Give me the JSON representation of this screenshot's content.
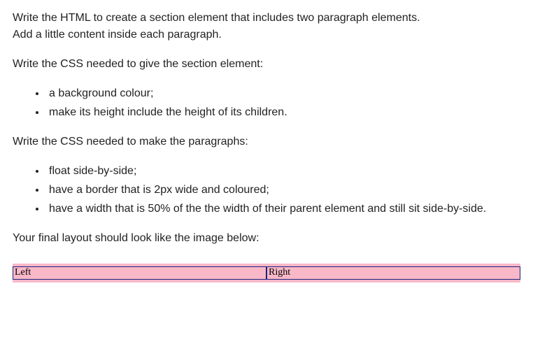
{
  "intro": {
    "line1": "Write the HTML to create a section element that includes two paragraph elements.",
    "line2": "Add a little content inside each paragraph."
  },
  "section_css_intro": "Write the CSS needed to give the section element:",
  "section_css_items": [
    "a background colour;",
    "make its height include the height of its children."
  ],
  "para_css_intro": "Write the CSS needed to make the paragraphs:",
  "para_css_items": [
    "float side-by-side;",
    "have a border that is 2px wide and coloured;",
    "have a width that is 50% of the the width of their parent element and still sit side-by-side."
  ],
  "final_layout_text": "Your final layout should look like the image below:",
  "demo": {
    "left": "Left",
    "right": "Right"
  }
}
